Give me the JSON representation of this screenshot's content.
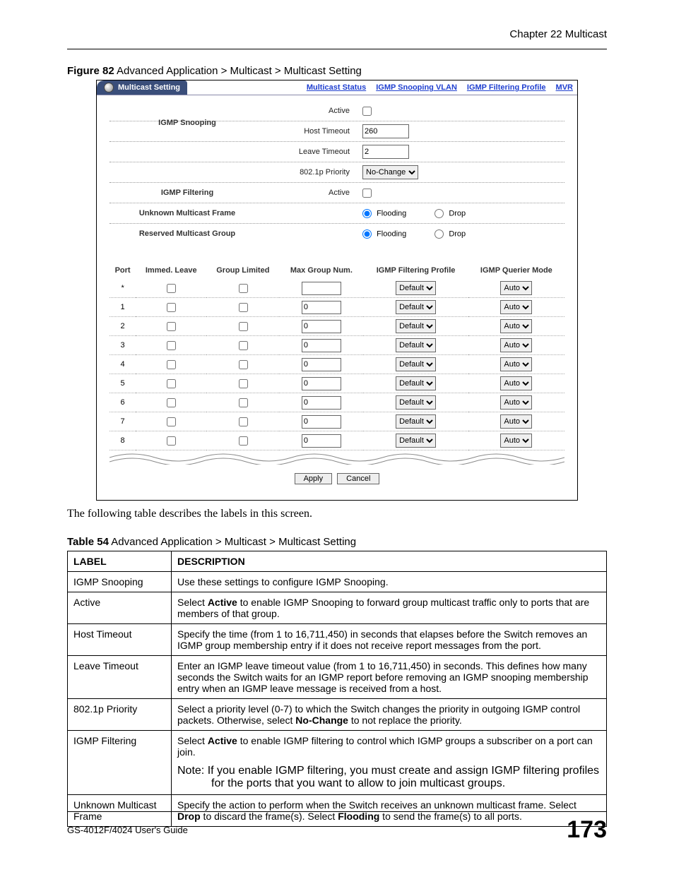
{
  "chapter_header": "Chapter 22 Multicast",
  "figure_caption_bold": "Figure 82",
  "figure_caption_rest": "   Advanced Application > Multicast > Multicast Setting",
  "tabbar": {
    "active": "Multicast Setting",
    "links": [
      "Multicast Status",
      "IGMP Snooping VLAN",
      "IGMP Filtering Profile",
      "MVR"
    ]
  },
  "form_groups": [
    {
      "span": "IGMP Snooping",
      "rows": [
        {
          "label": "Active",
          "type": "checkbox",
          "checked": false
        },
        {
          "label": "Host Timeout",
          "type": "text",
          "value": "260"
        },
        {
          "label": "Leave Timeout",
          "type": "text",
          "value": "2"
        },
        {
          "label": "802.1p Priority",
          "type": "select",
          "value": "No-Change"
        }
      ]
    },
    {
      "span": "IGMP Filtering",
      "rows": [
        {
          "label": "Active",
          "type": "checkbox",
          "checked": false
        }
      ]
    },
    {
      "span": "Unknown Multicast Frame",
      "rows": [
        {
          "label": "",
          "type": "radio",
          "options": [
            "Flooding",
            "Drop"
          ],
          "selected": "Flooding"
        }
      ]
    },
    {
      "span": "Reserved Multicast Group",
      "rows": [
        {
          "label": "",
          "type": "radio",
          "options": [
            "Flooding",
            "Drop"
          ],
          "selected": "Flooding"
        }
      ]
    }
  ],
  "ports_headers": [
    "Port",
    "Immed. Leave",
    "Group Limited",
    "Max Group Num.",
    "IGMP Filtering Profile",
    "IGMP Querier Mode"
  ],
  "ports_rows": [
    {
      "port": "*",
      "immed": false,
      "gl": false,
      "max": "",
      "profile": "Default",
      "mode": "Auto"
    },
    {
      "port": "1",
      "immed": false,
      "gl": false,
      "max": "0",
      "profile": "Default",
      "mode": "Auto"
    },
    {
      "port": "2",
      "immed": false,
      "gl": false,
      "max": "0",
      "profile": "Default",
      "mode": "Auto"
    },
    {
      "port": "3",
      "immed": false,
      "gl": false,
      "max": "0",
      "profile": "Default",
      "mode": "Auto"
    },
    {
      "port": "4",
      "immed": false,
      "gl": false,
      "max": "0",
      "profile": "Default",
      "mode": "Auto"
    },
    {
      "port": "5",
      "immed": false,
      "gl": false,
      "max": "0",
      "profile": "Default",
      "mode": "Auto"
    },
    {
      "port": "6",
      "immed": false,
      "gl": false,
      "max": "0",
      "profile": "Default",
      "mode": "Auto"
    },
    {
      "port": "7",
      "immed": false,
      "gl": false,
      "max": "0",
      "profile": "Default",
      "mode": "Auto"
    },
    {
      "port": "8",
      "immed": false,
      "gl": false,
      "max": "0",
      "profile": "Default",
      "mode": "Auto"
    }
  ],
  "buttons": {
    "apply": "Apply",
    "cancel": "Cancel"
  },
  "body_text": "The following table describes the labels in this screen.",
  "table_caption_bold": "Table 54",
  "table_caption_rest": "   Advanced Application > Multicast > Multicast Setting",
  "desc_headers": {
    "label": "LABEL",
    "desc": "DESCRIPTION"
  },
  "desc_rows": [
    {
      "label": "IGMP Snooping",
      "desc": "Use these settings to configure IGMP Snooping."
    },
    {
      "label": "Active",
      "desc": "Select <b>Active</b> to enable IGMP Snooping to forward group multicast traffic only to ports that are members of that group."
    },
    {
      "label": "Host Timeout",
      "desc": "Specify the time (from 1 to 16,711,450) in seconds that elapses before the Switch removes an IGMP group membership entry if it does not receive report messages from the port."
    },
    {
      "label": "Leave Timeout",
      "desc": "Enter an IGMP leave timeout value (from 1 to 16,711,450) in seconds. This defines how many seconds the Switch waits for an IGMP report before removing an IGMP snooping membership entry when an IGMP leave message is received from a host."
    },
    {
      "label": "802.1p Priority",
      "desc": "Select a priority level (0-7) to which the Switch changes the priority in outgoing IGMP control packets. Otherwise, select <b>No-Change</b> to not replace the priority."
    },
    {
      "label": "IGMP Filtering",
      "desc": "Select <b>Active</b> to enable IGMP filtering to control which IGMP groups a subscriber on a port can join.",
      "note": "Note: If you enable IGMP filtering, you must create and assign IGMP filtering profiles for the ports that you want to allow to join multicast groups."
    },
    {
      "label": "Unknown Multicast Frame",
      "desc": "Specify the action to perform when the Switch receives an unknown multicast frame. Select <b>Drop</b> to discard the frame(s). Select <b>Flooding</b> to send the frame(s) to all ports."
    }
  ],
  "footer_left": "GS-4012F/4024 User's Guide",
  "page_number": "173"
}
